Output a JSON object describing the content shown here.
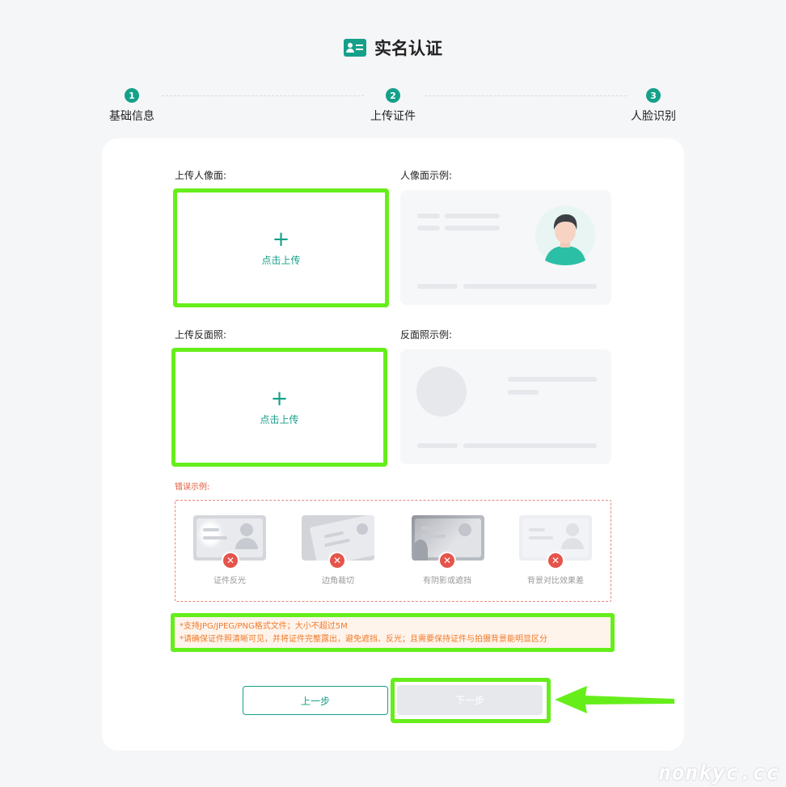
{
  "header": {
    "title": "实名认证",
    "icon": "id-card-icon"
  },
  "steps": [
    {
      "number": "1",
      "label": "基础信息"
    },
    {
      "number": "2",
      "label": "上传证件"
    },
    {
      "number": "3",
      "label": "人脸识别"
    }
  ],
  "upload_front": {
    "label": "上传人像面:",
    "plus": "+",
    "button_text": "点击上传"
  },
  "example_front": {
    "label": "人像面示例:"
  },
  "upload_back": {
    "label": "上传反面照:",
    "plus": "+",
    "button_text": "点击上传"
  },
  "example_back": {
    "label": "反面照示例:"
  },
  "errors": {
    "label": "错误示例:",
    "items": [
      {
        "caption": "证件反光"
      },
      {
        "caption": "边角裁切"
      },
      {
        "caption": "有阴影或遮挡"
      },
      {
        "caption": "背景对比效果差"
      }
    ]
  },
  "notice": {
    "line1": "*支持JPG/JPEG/PNG格式文件；大小不超过5M",
    "line2": "*请确保证件照清晰可见，并将证件完整露出，避免遮挡、反光；且需要保持证件与拍摄背景能明显区分"
  },
  "buttons": {
    "prev": "上一步",
    "next": "下一步"
  },
  "watermark": "nonkyc.cc",
  "colors": {
    "accent": "#15a089",
    "highlight": "#66ee1a",
    "error": "#e5544b",
    "notice_text": "#f07a2a"
  }
}
